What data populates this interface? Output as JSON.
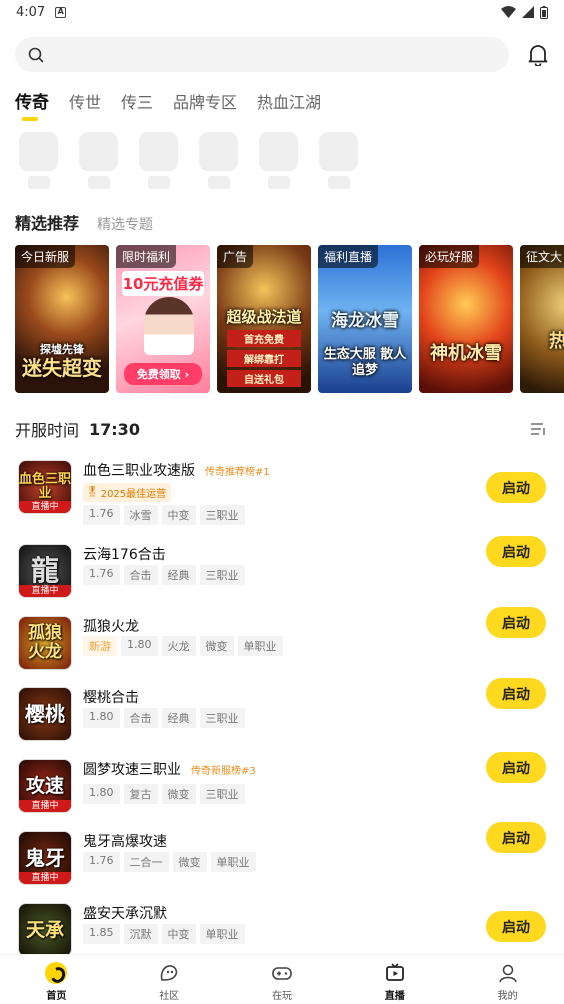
{
  "status_bar": {
    "time": "4:07",
    "notif_glyph": "A"
  },
  "search": {
    "placeholder": ""
  },
  "tabs": [
    "传奇",
    "传世",
    "传三",
    "品牌专区",
    "热血江湖"
  ],
  "featured": {
    "title": "精选推荐",
    "subtitle": "精选专题"
  },
  "banners": [
    {
      "tag": "今日新服",
      "art": "迷失超变",
      "top": "探墟先锋"
    },
    {
      "tag": "限时福利",
      "price": "10元充值券",
      "cta": "免费领取 ›"
    },
    {
      "tag": "广告",
      "art": "超级战法道",
      "pills": [
        "首充免费",
        "解绑靠打",
        "自送礼包"
      ]
    },
    {
      "tag": "福利直播",
      "art": "海龙冰雪",
      "sub": "生态大服 散人追梦"
    },
    {
      "tag": "必玩好服",
      "art": "神机冰雪"
    },
    {
      "tag": "征文大",
      "art": "热血"
    }
  ],
  "server": {
    "label": "开服时间",
    "time": "17:30"
  },
  "games": [
    {
      "name": "血色三职业攻速版",
      "rank": "传奇推荐榜#1",
      "award": "2025最佳运营",
      "icon_text": "血色三职业",
      "live": "直播中",
      "tags": [
        "1.76",
        "冰雪",
        "中变",
        "三职业"
      ]
    },
    {
      "name": "云海176合击",
      "icon_text": "龍",
      "live": "直播中",
      "tags": [
        "1.76",
        "合击",
        "经典",
        "三职业"
      ]
    },
    {
      "name": "孤狼火龙",
      "icon_text": "孤狼火龙",
      "tags": [
        "新游",
        "1.80",
        "火龙",
        "微变",
        "单职业"
      ]
    },
    {
      "name": "樱桃合击",
      "icon_text": "樱桃",
      "tags": [
        "1.80",
        "合击",
        "经典",
        "三职业"
      ]
    },
    {
      "name": "圆梦攻速三职业",
      "rank": "传奇新服榜#3",
      "icon_text": "攻速",
      "live": "直播中",
      "tags": [
        "1.80",
        "复古",
        "微变",
        "三职业"
      ]
    },
    {
      "name": "鬼牙高爆攻速",
      "icon_text": "鬼牙",
      "live": "直播中",
      "tags": [
        "1.76",
        "二合一",
        "微变",
        "单职业"
      ]
    },
    {
      "name": "盛安天承沉默",
      "icon_text": "天承",
      "tags": [
        "1.85",
        "沉默",
        "中变",
        "单职业"
      ]
    }
  ],
  "start_label": "启动",
  "nav": [
    "首页",
    "社区",
    "在玩",
    "直播",
    "我的"
  ],
  "colors": {
    "accent": "#ffd91f",
    "rank": "#f08c1a",
    "live": "#d01a1a"
  }
}
